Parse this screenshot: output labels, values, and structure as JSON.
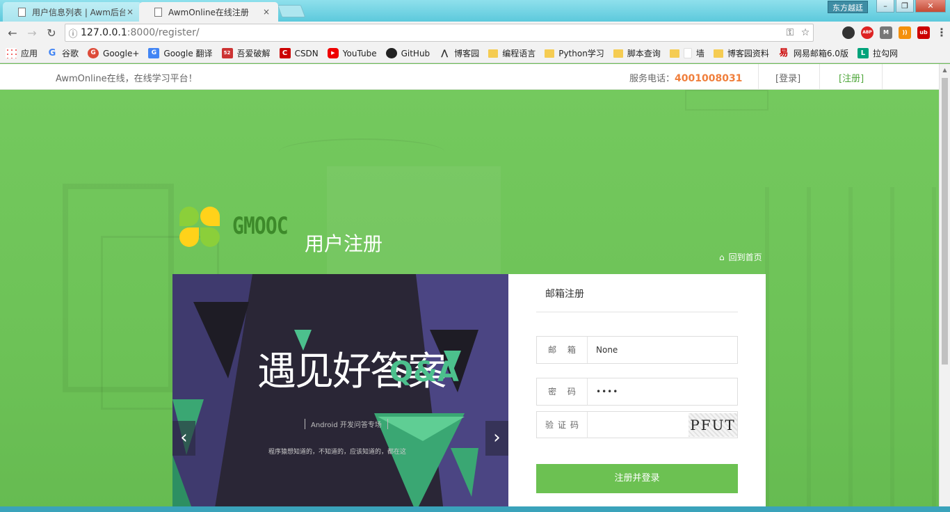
{
  "browser": {
    "tabs": [
      {
        "title": "用户信息列表 | Awm后台",
        "active": false
      },
      {
        "title": "AwmOnline在线注册",
        "active": true
      }
    ],
    "close_glyph": "×",
    "ime_label": "东方越廷",
    "url_host": "127.0.0.1",
    "url_path": ":8000/register/",
    "bookmarks": [
      {
        "label": "应用",
        "icon": "apps-icon"
      },
      {
        "label": "谷歌",
        "icon": "google-icon"
      },
      {
        "label": "Google+",
        "icon": "google-plus-icon"
      },
      {
        "label": "Google 翻译",
        "icon": "translate-icon"
      },
      {
        "label": "吾爱破解",
        "icon": "52pojie-icon"
      },
      {
        "label": "CSDN",
        "icon": "csdn-icon"
      },
      {
        "label": "YouTube",
        "icon": "youtube-icon"
      },
      {
        "label": "GitHub",
        "icon": "github-icon"
      },
      {
        "label": "博客园",
        "icon": "cnblogs-icon"
      },
      {
        "label": "编程语言",
        "icon": "folder-icon"
      },
      {
        "label": "Python学习",
        "icon": "folder-icon"
      },
      {
        "label": "脚本查询",
        "icon": "folder-icon"
      },
      {
        "label": "墙",
        "icon": "folder-icon"
      },
      {
        "label": "博客园资料",
        "icon": "folder-icon"
      },
      {
        "label": "网易邮箱6.0版",
        "icon": "163-mail-icon"
      },
      {
        "label": "拉勾网",
        "icon": "lagou-icon"
      }
    ]
  },
  "site": {
    "slogan": "AwmOnline在线，在线学习平台！",
    "phone_label": "服务电话：",
    "phone_number": "4001008031",
    "login_link": "[登录]",
    "register_link": "[注册]",
    "brand": "GMOOC",
    "page_title": "用户注册",
    "home_link": "回到首页"
  },
  "carousel": {
    "headline": "遇见好答案",
    "sub": "Android 开发问答专场",
    "desc": "程序猿想知道的，不知道的，应该知道的，都在这",
    "qa": "Q&A"
  },
  "form": {
    "tab_title": "邮箱注册",
    "email_label": "邮 箱",
    "email_value": "None",
    "password_label": "密 码",
    "password_value": "••••",
    "captcha_label": "验证码",
    "captcha_text": "PFUT",
    "submit_label": "注册并登录"
  },
  "colors": {
    "accent_green": "#6cc152",
    "phone_orange": "#f07f3c"
  }
}
